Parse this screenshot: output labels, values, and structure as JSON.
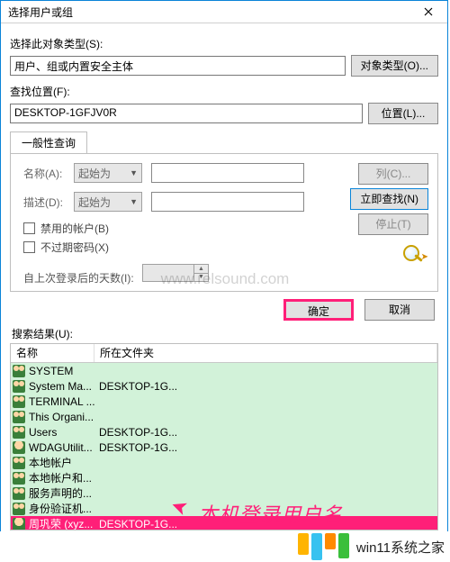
{
  "window": {
    "title": "选择用户或组"
  },
  "object_type": {
    "label": "选择此对象类型(S):",
    "value": "用户、组或内置安全主体",
    "button": "对象类型(O)..."
  },
  "location": {
    "label": "查找位置(F):",
    "value": "DESKTOP-1GFJV0R",
    "button": "位置(L)..."
  },
  "tab": {
    "title": "一般性查询",
    "name_label": "名称(A):",
    "name_mode": "起始为",
    "desc_label": "描述(D):",
    "desc_mode": "起始为",
    "chk_disabled": "禁用的帐户(B)",
    "chk_noexpire": "不过期密码(X)",
    "days_label": "自上次登录后的天数(I):"
  },
  "side_buttons": {
    "columns": "列(C)...",
    "find_now": "立即查找(N)",
    "stop": "停止(T)"
  },
  "dlg": {
    "ok": "确定",
    "cancel": "取消"
  },
  "results": {
    "label": "搜索结果(U):",
    "col_name": "名称",
    "col_folder": "所在文件夹",
    "rows": [
      {
        "icon": "group",
        "name": "SYSTEM",
        "folder": ""
      },
      {
        "icon": "group",
        "name": "System Ma...",
        "folder": "DESKTOP-1G..."
      },
      {
        "icon": "group",
        "name": "TERMINAL ...",
        "folder": ""
      },
      {
        "icon": "group",
        "name": "This Organi...",
        "folder": ""
      },
      {
        "icon": "group",
        "name": "Users",
        "folder": "DESKTOP-1G..."
      },
      {
        "icon": "user",
        "name": "WDAGUtilit...",
        "folder": "DESKTOP-1G..."
      },
      {
        "icon": "group",
        "name": "本地帐户",
        "folder": ""
      },
      {
        "icon": "group",
        "name": "本地帐户和...",
        "folder": ""
      },
      {
        "icon": "group",
        "name": "服务声明的...",
        "folder": ""
      },
      {
        "icon": "group",
        "name": "身份验证机...",
        "folder": ""
      },
      {
        "icon": "user",
        "name": "周巩荣 (xyz...",
        "folder": "DESKTOP-1G...",
        "selected": true
      }
    ]
  },
  "annotation": {
    "text": "本机登录用户名"
  },
  "watermark": "www.relsound.com",
  "footer_site": "win11系统之家"
}
